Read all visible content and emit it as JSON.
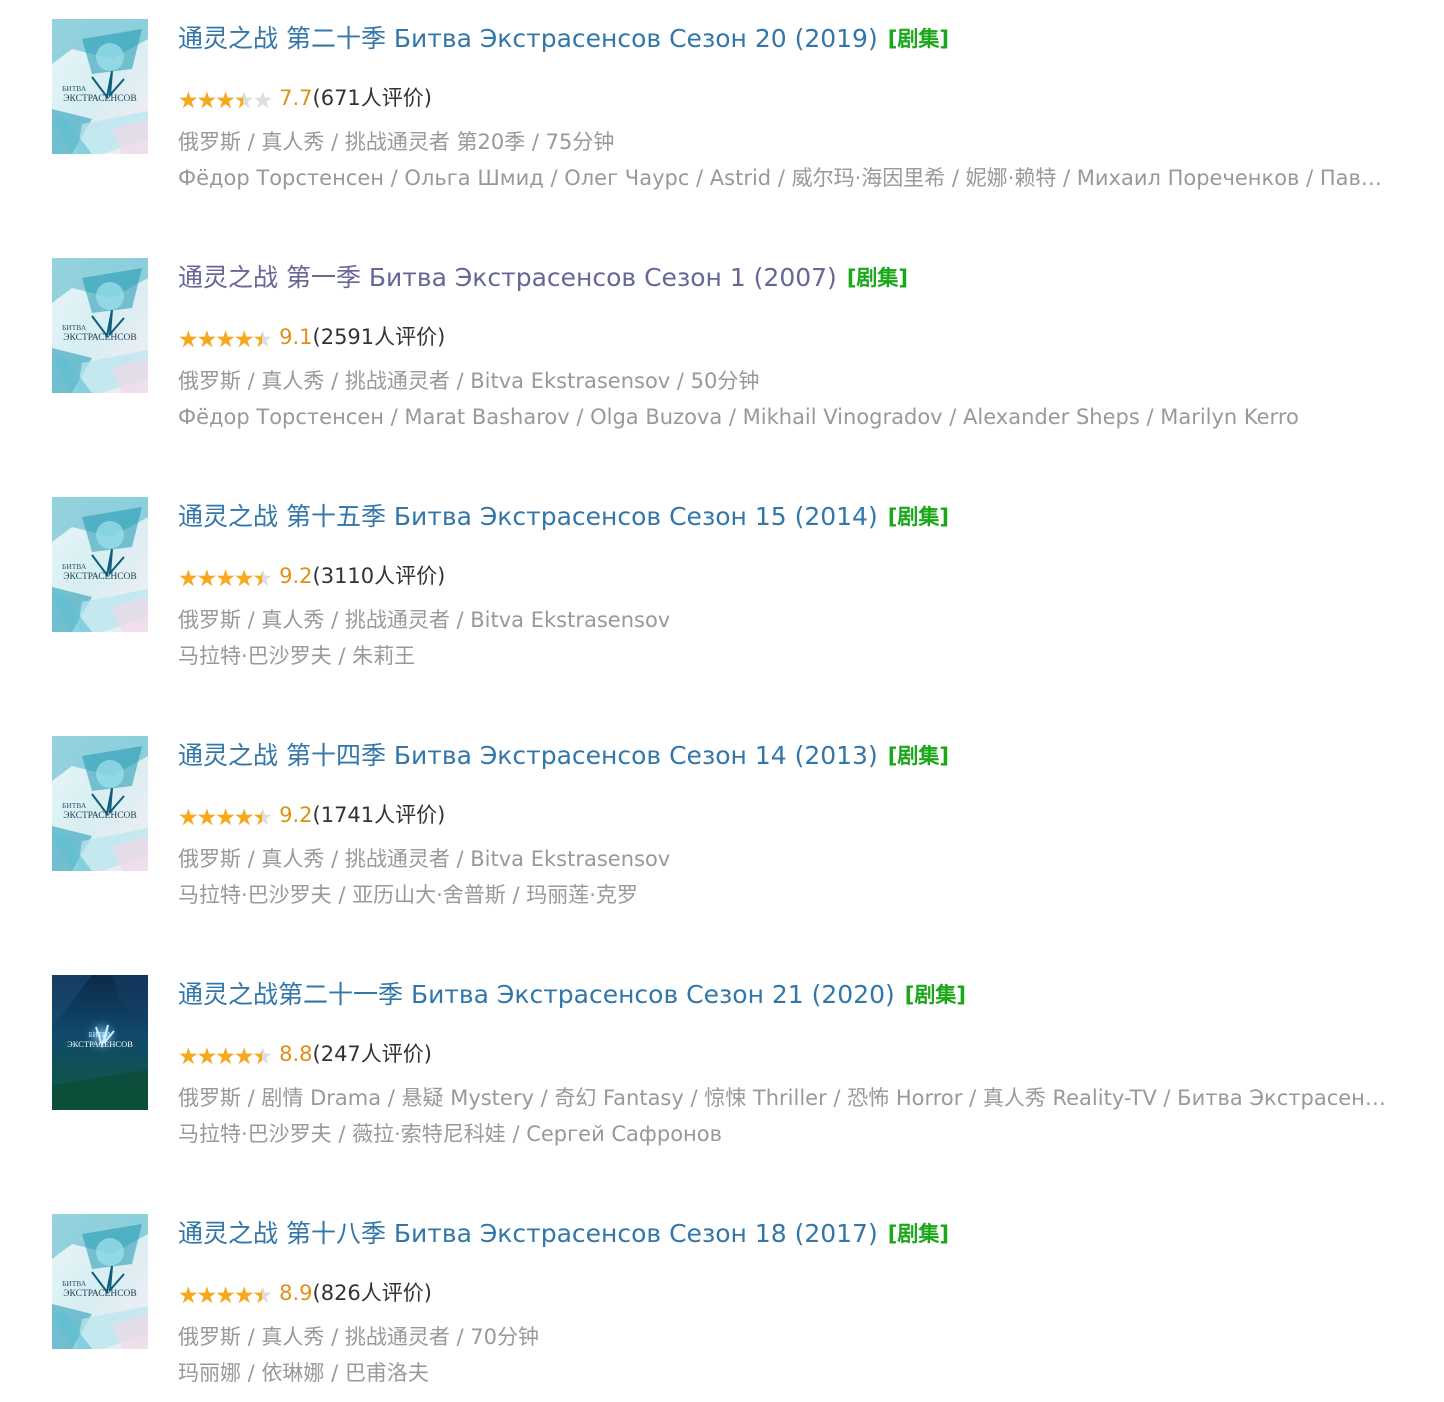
{
  "results": [
    {
      "title": "通灵之战 第二十季 Битва Экстрасенсов Сезон 20 (2019)",
      "tag": "[剧集]",
      "stars": 3.5,
      "score": "7.7",
      "votes": "(671人评价)",
      "meta": "俄罗斯 / 真人秀 / 挑战通灵者 第20季 / 75分钟",
      "cast": "Фёдор Торстенсен / Ольга Шмид / Олег Чаурс / Astrid / 威尔玛·海因里希 / 妮娜·赖特 / Михаил Пореченков / Павел Воля",
      "poster": "light",
      "visited": false
    },
    {
      "title": "通灵之战 第一季 Битва Экстрасенсов Сезон 1 (2007)",
      "tag": "[剧集]",
      "stars": 4.5,
      "score": "9.1",
      "votes": "(2591人评价)",
      "meta": "俄罗斯 / 真人秀 / 挑战通灵者 / Bitva Ekstrasensov / 50分钟",
      "cast": "Фёдор Торстенсен / Marat Basharov / Olga Buzova / Mikhail Vinogradov / Alexander Sheps / Marilyn Kerro",
      "poster": "light",
      "visited": true
    },
    {
      "title": "通灵之战 第十五季 Битва Экстрасенсов Сезон 15 (2014)",
      "tag": "[剧集]",
      "stars": 4.5,
      "score": "9.2",
      "votes": "(3110人评价)",
      "meta": "俄罗斯 / 真人秀 / 挑战通灵者 / Bitva Ekstrasensov",
      "cast": "马拉特·巴沙罗夫 / 朱莉王",
      "poster": "light",
      "visited": false
    },
    {
      "title": "通灵之战 第十四季 Битва Экстрасенсов Сезон 14 (2013)",
      "tag": "[剧集]",
      "stars": 4.5,
      "score": "9.2",
      "votes": "(1741人评价)",
      "meta": "俄罗斯 / 真人秀 / 挑战通灵者 / Bitva Ekstrasensov",
      "cast": "马拉特·巴沙罗夫 / 亚历山大·舍普斯 / 玛丽莲·克罗",
      "poster": "light",
      "visited": false
    },
    {
      "title": "通灵之战第二十一季 Битва Экстрасенсов Сезон 21 (2020)",
      "tag": "[剧集]",
      "stars": 4.5,
      "score": "8.8",
      "votes": "(247人评价)",
      "meta": "俄罗斯 / 剧情 Drama / 悬疑 Mystery / 奇幻 Fantasy / 惊悚 Thriller / 恐怖 Horror / 真人秀 Reality-TV / Битва Экстрасенсов",
      "cast": "马拉特·巴沙罗夫 / 薇拉·索特尼科娃 / Сергей Сафронов",
      "poster": "dark",
      "visited": false
    },
    {
      "title": "通灵之战 第十八季 Битва Экстрасенсов Сезон 18 (2017)",
      "tag": "[剧集]",
      "stars": 4.5,
      "score": "8.9",
      "votes": "(826人评价)",
      "meta": "俄罗斯 / 真人秀 / 挑战通灵者 / 70分钟",
      "cast": "玛丽娜 / 依琳娜 / 巴甫洛夫",
      "poster": "light",
      "visited": false
    }
  ],
  "poster_text": {
    "line1": "БИТВА",
    "line2": "ЭКСТРАСЕНСОВ"
  },
  "colors": {
    "title": "#3377aa",
    "title_visited": "#666699",
    "tag": "#1aa71a",
    "star": "#f7a81b",
    "score": "#e09015",
    "meta": "#999999"
  }
}
